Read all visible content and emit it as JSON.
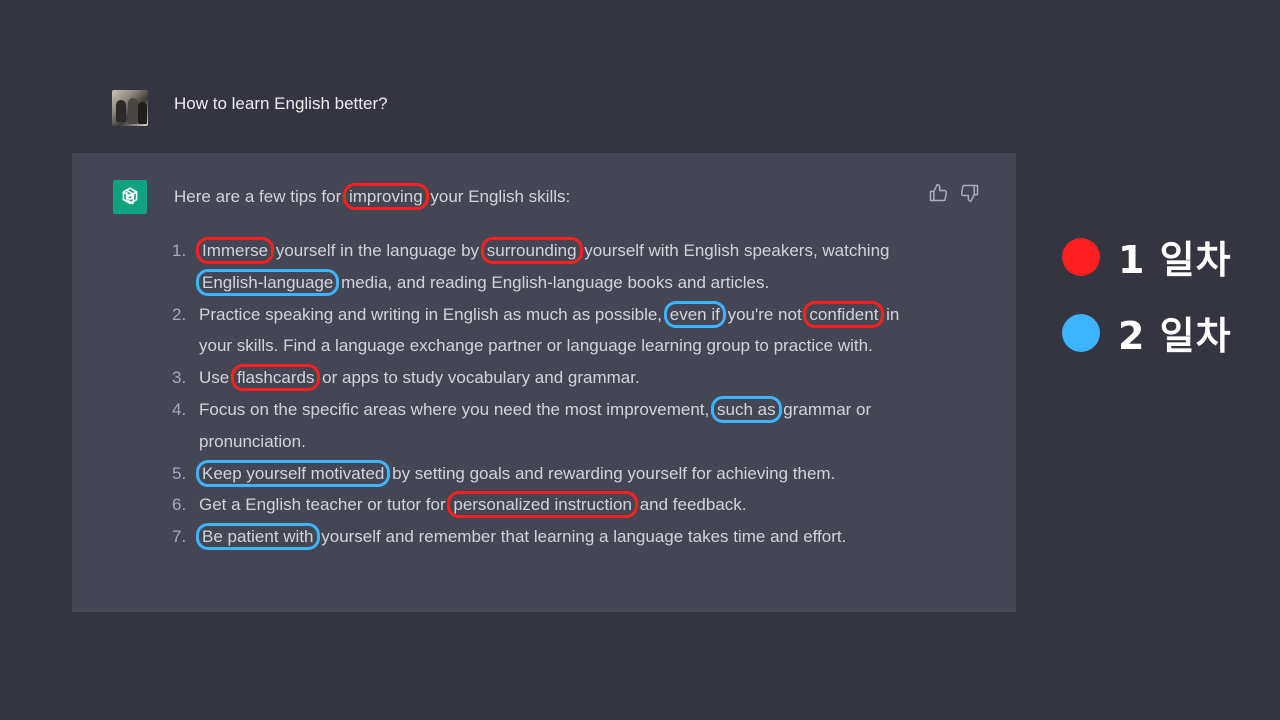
{
  "user": {
    "avatar_icon": "user-avatar-photo",
    "message": "How to learn English better?"
  },
  "assistant": {
    "icon": "openai-logo-icon",
    "icon_color": "#10a37f",
    "intro": {
      "before": "Here are a few tips for ",
      "highlight": "improving",
      "highlight_color": "red",
      "after": " your English skills:"
    },
    "feedback": {
      "thumbs_up_icon": "thumbs-up-icon",
      "thumbs_down_icon": "thumbs-down-icon"
    },
    "tips": [
      {
        "number": "1.",
        "segments": [
          {
            "text": "Immerse",
            "hl": "red"
          },
          {
            "text": " yourself in the language by "
          },
          {
            "text": "surrounding",
            "hl": "red"
          },
          {
            "text": " yourself with English speakers, watching "
          },
          {
            "text": "English-language",
            "hl": "blue"
          },
          {
            "text": " media, and reading English-language books and articles."
          }
        ]
      },
      {
        "number": "2.",
        "segments": [
          {
            "text": "Practice speaking and writing in English as much as possible, "
          },
          {
            "text": "even if",
            "hl": "blue"
          },
          {
            "text": " you're not "
          },
          {
            "text": "confident",
            "hl": "red"
          },
          {
            "text": " in your skills. Find a language exchange partner or language learning group to practice with."
          }
        ]
      },
      {
        "number": "3.",
        "segments": [
          {
            "text": "Use "
          },
          {
            "text": "flashcards",
            "hl": "red"
          },
          {
            "text": " or apps to study vocabulary and grammar."
          }
        ]
      },
      {
        "number": "4.",
        "segments": [
          {
            "text": "Focus on the specific areas where you need the most improvement, "
          },
          {
            "text": "such as",
            "hl": "blue"
          },
          {
            "text": " grammar or pronunciation."
          }
        ]
      },
      {
        "number": "5.",
        "segments": [
          {
            "text": "Keep yourself motivated",
            "hl": "blue"
          },
          {
            "text": " by setting goals and rewarding yourself for achieving them."
          }
        ]
      },
      {
        "number": "6.",
        "segments": [
          {
            "text": "Get a English teacher or tutor for "
          },
          {
            "text": "personalized instruction",
            "hl": "red"
          },
          {
            "text": " and feedback."
          }
        ]
      },
      {
        "number": "7.",
        "segments": [
          {
            "text": "Be patient with",
            "hl": "blue"
          },
          {
            "text": " yourself and remember that learning a language takes time and effort."
          }
        ]
      }
    ]
  },
  "legend": [
    {
      "label": "1 일차",
      "color": "#ff1f1f"
    },
    {
      "label": "2 일차",
      "color": "#3eb3ff"
    }
  ]
}
